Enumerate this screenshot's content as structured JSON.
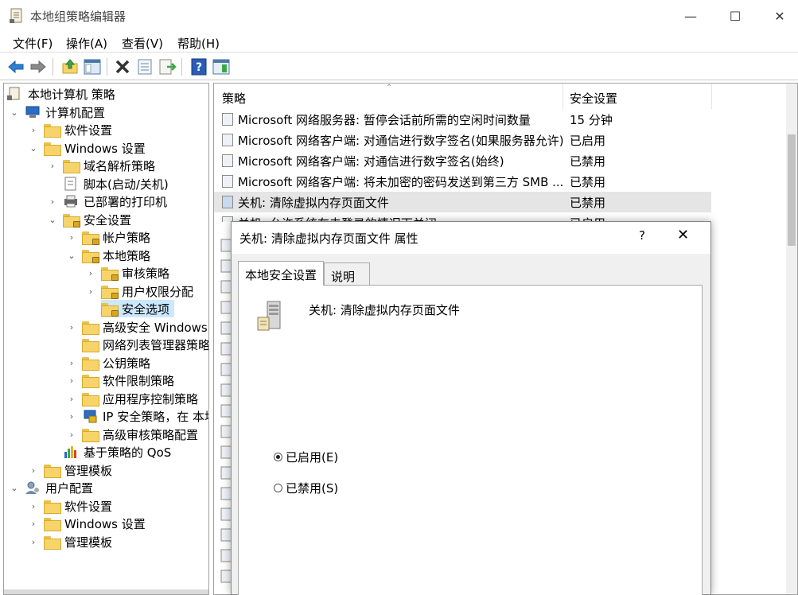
{
  "window": {
    "title": "本地组策略编辑器",
    "minimize": "—",
    "maximize": "☐",
    "close": "✕"
  },
  "menu": [
    "文件(F)",
    "操作(A)",
    "查看(V)",
    "帮助(H)"
  ],
  "tree": {
    "root": "本地计算机 策略",
    "computer_config": "计算机配置",
    "software_settings": "软件设置",
    "windows_settings": "Windows 设置",
    "dns_policy": "域名解析策略",
    "scripts": "脚本(启动/关机)",
    "printers": "已部署的打印机",
    "security_settings": "安全设置",
    "account_policy": "帐户策略",
    "local_policy": "本地策略",
    "audit_policy": "审核策略",
    "user_rights": "用户权限分配",
    "security_options": "安全选项",
    "advanced_firewall": "高级安全 Windows",
    "network_list": "网络列表管理器策略",
    "public_key": "公钥策略",
    "software_restriction": "软件限制策略",
    "app_control": "应用程序控制策略",
    "ip_security": "IP 安全策略，在 本地",
    "advanced_audit": "高级审核策略配置",
    "qos": "基于策略的 QoS",
    "admin_templates": "管理模板",
    "user_config": "用户配置",
    "user_software": "软件设置",
    "user_windows": "Windows 设置",
    "user_admin_templates": "管理模板"
  },
  "list": {
    "col_policy": "策略",
    "col_setting": "安全设置",
    "rows": [
      {
        "name": "Microsoft 网络服务器: 暂停会话前所需的空闲时间数量",
        "value": "15 分钟"
      },
      {
        "name": "Microsoft 网络客户端: 对通信进行数字签名(如果服务器允许)",
        "value": "已启用"
      },
      {
        "name": "Microsoft 网络客户端: 对通信进行数字签名(始终)",
        "value": "已禁用"
      },
      {
        "name": "Microsoft 网络客户端: 将未加密的密码发送到第三方 SMB ...",
        "value": "已禁用"
      },
      {
        "name": "关机: 清除虚拟内存页面文件",
        "value": "已禁用"
      },
      {
        "name": "关机: 允许系统在未登录的情况下关闭",
        "value": "已启用"
      }
    ]
  },
  "dialog": {
    "title": "关机: 清除虚拟内存页面文件 属性",
    "help": "?",
    "close": "✕",
    "tab_local": "本地安全设置",
    "tab_explain": "说明",
    "heading": "关机: 清除虚拟内存页面文件",
    "option_enabled": "已启用(E)",
    "option_disabled": "已禁用(S)",
    "selected": "enabled"
  }
}
